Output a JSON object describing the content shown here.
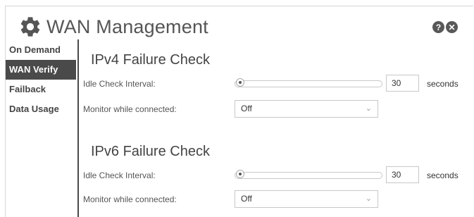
{
  "window": {
    "title": "WAN Management"
  },
  "header_icons": {
    "help": "?",
    "close": "✕"
  },
  "sidebar": {
    "items": [
      {
        "label": "On Demand",
        "active": false
      },
      {
        "label": "WAN Verify",
        "active": true
      },
      {
        "label": "Failback",
        "active": false
      },
      {
        "label": "Data Usage",
        "active": false
      }
    ]
  },
  "ipv4": {
    "title": "IPv4 Failure Check",
    "idle_label": "Idle Check Interval:",
    "idle_value": "30",
    "idle_unit": "seconds",
    "monitor_label": "Monitor while connected:",
    "monitor_value": "Off"
  },
  "ipv6": {
    "title": "IPv6 Failure Check",
    "idle_label": "Idle Check Interval:",
    "idle_value": "30",
    "idle_unit": "seconds",
    "monitor_label": "Monitor while connected:",
    "monitor_value": "Off"
  },
  "colors": {
    "active_bg": "#4a4a4a",
    "icon": "#585858"
  }
}
